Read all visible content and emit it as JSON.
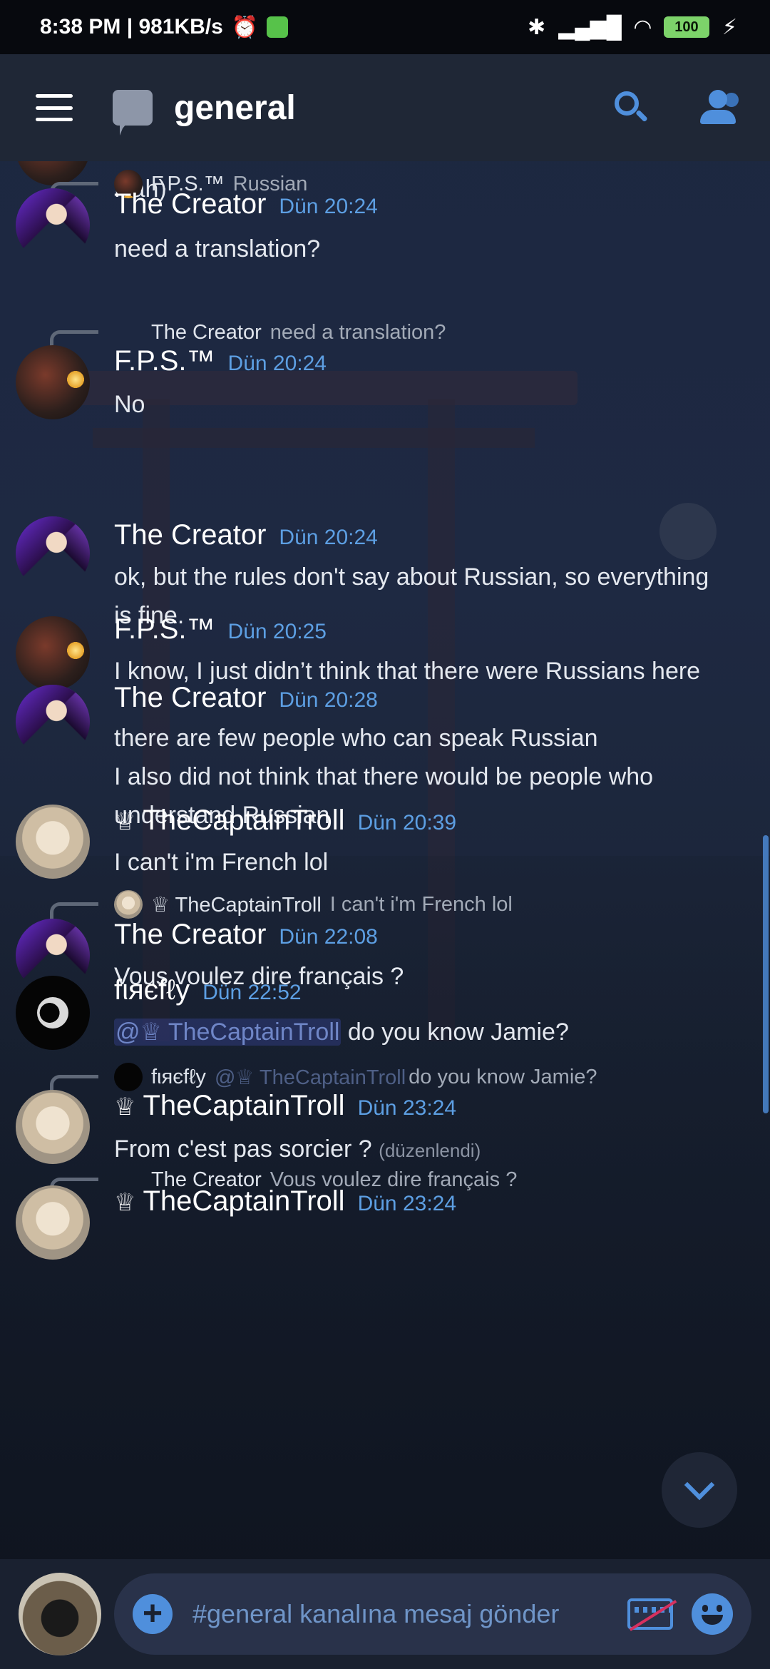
{
  "status_bar": {
    "time_speed": "8:38 PM | 981KB/s",
    "battery": "100"
  },
  "header": {
    "channel_name": "general"
  },
  "messages": [
    {
      "text": "Hah)"
    },
    {
      "reply_to": {
        "name": "F.P.S.™",
        "text": "Russian"
      },
      "author": "The Creator",
      "time": "Dün 20:24",
      "lines": [
        "need a translation?"
      ]
    },
    {
      "reply_to": {
        "name": "The Creator",
        "text": "need a translation?"
      },
      "author": "F.P.S.™",
      "time": "Dün 20:24",
      "lines": [
        "No"
      ]
    },
    {
      "author": "The Creator",
      "time": "Dün 20:24",
      "lines": [
        "ok, but the rules don't say about Russian, so everything",
        "is fine."
      ]
    },
    {
      "author": "F.P.S.™",
      "time": "Dün 20:25",
      "lines": [
        "I know, I just didn’t think that there were Russians here"
      ]
    },
    {
      "author": "The Creator",
      "time": "Dün 20:28",
      "lines": [
        "there are few people who can speak Russian",
        "I also did not think that there would be people who",
        "understand Russian"
      ]
    },
    {
      "author": "TheCaptainTroll",
      "time": "Dün 20:39",
      "lines": [
        "I can't i'm French lol"
      ]
    },
    {
      "reply_to": {
        "name": "TheCaptainTroll",
        "text": "I can't i'm French lol"
      },
      "author": "The Creator",
      "time": "Dün 22:08",
      "lines": [
        "Vous voulez dire français ?"
      ]
    },
    {
      "author": "fιяєfℓу",
      "time": "Dün 22:52",
      "mention": "@♕ TheCaptainTroll",
      "rest": " do you know Jamie?"
    },
    {
      "reply_to": {
        "name": "fιяєfℓу",
        "mention": "@♕ TheCaptainTroll",
        "text": "do you know Jamie?"
      },
      "author": "TheCaptainTroll",
      "time": "Dün 23:24",
      "lines": [
        "From c'est pas sorcier ?"
      ],
      "edited": "(düzenlendi)"
    },
    {
      "reply_to": {
        "name": "The Creator",
        "text": "Vous voulez dire français ?"
      },
      "author": "TheCaptainTroll",
      "time": "Dün 23:24"
    }
  ],
  "composer": {
    "placeholder": "#general kanalına mesaj gönder"
  },
  "icons": {
    "crown": "♕"
  },
  "colors": {
    "accent": "#4f8fdc",
    "timestamp": "#5d9fe3",
    "header_bg": "#1f2736"
  }
}
